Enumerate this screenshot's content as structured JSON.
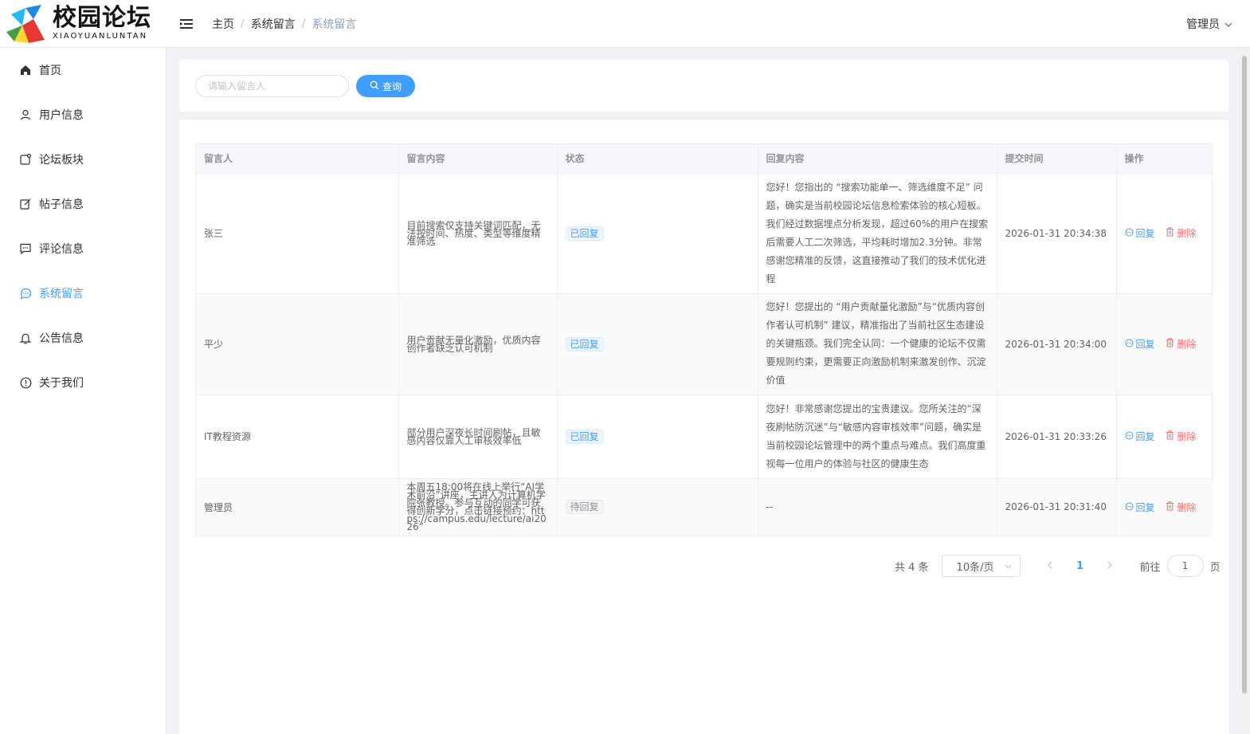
{
  "app": {
    "title": "校园论坛",
    "subtitle": "XIAOYUANLUNTAN"
  },
  "breadcrumb": [
    "主页",
    "系统留言",
    "系统留言"
  ],
  "user": {
    "name": "管理员"
  },
  "sidebar": {
    "items": [
      {
        "label": "首页",
        "icon": "home-icon",
        "active": false
      },
      {
        "label": "用户信息",
        "icon": "user-icon",
        "active": false
      },
      {
        "label": "论坛板块",
        "icon": "board-icon",
        "active": false
      },
      {
        "label": "帖子信息",
        "icon": "edit-icon",
        "active": false
      },
      {
        "label": "评论信息",
        "icon": "comment-icon",
        "active": false
      },
      {
        "label": "系统留言",
        "icon": "chat-icon",
        "active": true
      },
      {
        "label": "公告信息",
        "icon": "bell-icon",
        "active": false
      },
      {
        "label": "关于我们",
        "icon": "info-icon",
        "active": false
      }
    ]
  },
  "search": {
    "placeholder": "请输入留言人",
    "button_label": "查询"
  },
  "table": {
    "headers": [
      "留言人",
      "留言内容",
      "状态",
      "回复内容",
      "提交时间",
      "操作"
    ],
    "rows": [
      {
        "user": "张三",
        "content": "目前搜索仅支持关键词匹配，无法按时间、热度、类型等维度精准筛选",
        "status": "已回复",
        "reply": "您好！您指出的 “搜索功能单一、筛选维度不足” 问题，确实是当前校园论坛信息检索体验的核心短板。我们经过数据埋点分析发现，超过60%的用户在搜索后需要人工二次筛选，平均耗时增加2.3分钟。非常感谢您精准的反馈，这直接推动了我们的技术优化进程",
        "time": "2026-01-31 20:34:38",
        "reply_btn": "回复",
        "delete_btn": "删除"
      },
      {
        "user": "平少",
        "content": "用户贡献无量化激励，优质内容创作者缺乏认可机制",
        "status": "已回复",
        "reply": "您好！您提出的 “用户贡献量化激励”与“优质内容创作者认可机制” 建议，精准指出了当前社区生态建设的关键瓶颈。我们完全认同：一个健康的论坛不仅需要规则约束，更需要正向激励机制来激发创作、沉淀价值",
        "time": "2026-01-31 20:34:00",
        "reply_btn": "回复",
        "delete_btn": "删除"
      },
      {
        "user": "IT教程资源",
        "content": "部分用户深夜长时间刷帖，且敏感内容仅靠人工审核效率低",
        "status": "已回复",
        "reply": "您好！非常感谢您提出的宝贵建议。您所关注的“深夜刷帖防沉迷”与“敏感内容审核效率”问题，确实是当前校园论坛管理中的两个重点与难点。我们高度重视每一位用户的体验与社区的健康生态",
        "time": "2026-01-31 20:33:26",
        "reply_btn": "回复",
        "delete_btn": "删除"
      },
      {
        "user": "管理员",
        "content": "本周五18:00将在线上举行“AI学术前沿”讲座，主讲人为计算机学院张教授。参与互动的同学可获得创新学分，点击链接预约：https://campus.edu/lecture/ai2026”",
        "status": "待回复",
        "reply": "--",
        "time": "2026-01-31 20:31:40",
        "reply_btn": "回复",
        "delete_btn": "删除"
      }
    ]
  },
  "pagination": {
    "total_label": "共 4 条",
    "page_size": "10条/页",
    "current_page": "1",
    "goto_prefix": "前往",
    "goto_value": "1",
    "goto_suffix": "页"
  },
  "colors": {
    "primary": "#409eff",
    "danger": "#f56c6c",
    "background": "#f0f2f5"
  }
}
